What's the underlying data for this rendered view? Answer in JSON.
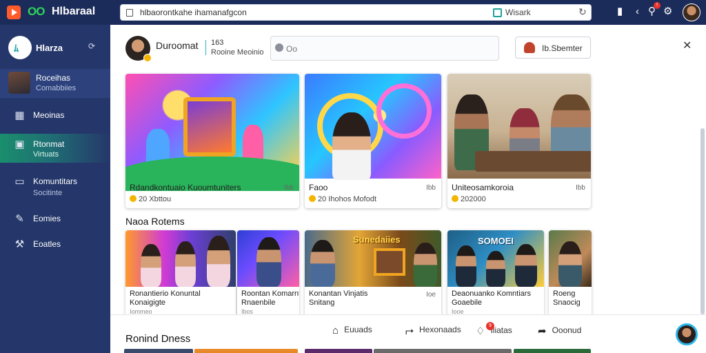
{
  "topbar": {
    "title": "Hlbaraal",
    "url": "hlbaorontkahe ihamanafgcon",
    "ext_label": "Wisark"
  },
  "sidebar": {
    "brand": "Hlarza",
    "profile": {
      "name": "Roceihas",
      "sub": "Comabbiies"
    },
    "items": [
      {
        "label": "Meoinas",
        "sub": "",
        "icon": "grid-icon"
      },
      {
        "label": "Rtonmat",
        "sub": "Virtuats",
        "icon": "monitor-icon"
      },
      {
        "label": "Komuntitars",
        "sub": "Socitinte",
        "icon": "chat-icon"
      },
      {
        "label": "Eomies",
        "sub": "",
        "icon": "pen-icon"
      },
      {
        "label": "Eoatles",
        "sub": "",
        "icon": "wrench-icon"
      }
    ]
  },
  "header": {
    "name": "Duroomat",
    "sub1": "163",
    "sub2": "Rooine Meoinio",
    "search_placeholder": "Oo",
    "button_label": "Ib.Sbemter"
  },
  "cards_row1": [
    {
      "title": "Rdandkontuaio Kuoumtuniters",
      "meta": "20  Xbttou",
      "side": "Ibb"
    },
    {
      "title": "Faoo",
      "meta": "20 Ihohos  Mofodt",
      "side": "Ibb"
    },
    {
      "title": "Uniteosamkoroia",
      "meta": "202000",
      "side": "Ibb"
    }
  ],
  "section2_title": "Naoa Rotems",
  "cards_row2": [
    {
      "title": "Ronantierio Konuntal",
      "sub": "Konaigigte",
      "meta": "Iommeo",
      "banner": ""
    },
    {
      "title": "Roontan Komarnt",
      "sub": "Rnaenbile",
      "meta": "Ibos",
      "banner": ""
    },
    {
      "title": "Konantan Vinjatis",
      "sub": "Snitang",
      "meta": "Ioe",
      "banner": "Sunedaiies"
    },
    {
      "title": "Deaonuanko Komntiars",
      "sub": "Goaebile",
      "meta": "Iooe",
      "banner": "SOMOEI"
    },
    {
      "title": "Roeng",
      "sub": "Snaocig",
      "meta": "",
      "banner": ""
    }
  ],
  "section3_title": "Ronind Dness",
  "bottom_nav": [
    {
      "label": "Euuads",
      "icon": "home-icon"
    },
    {
      "label": "Hexonaads",
      "icon": "share-icon"
    },
    {
      "label": "Iliatas",
      "icon": "bell-icon",
      "badge": "9"
    },
    {
      "label": "Ooonud",
      "icon": "forward-icon"
    }
  ],
  "colors": {
    "sidebar": "#25376a",
    "topbar": "#1c2c5a",
    "accent": "#1a8e6d",
    "badge": "#e8332d"
  }
}
